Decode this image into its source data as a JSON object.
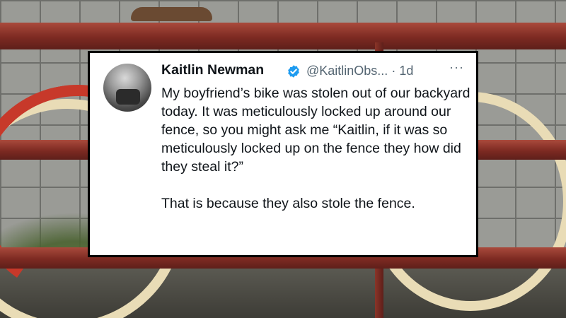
{
  "tweet": {
    "author_name": "Kaitlin Newman",
    "handle": "@KaitlinObs...",
    "separator": "·",
    "time": "1d",
    "more_label": "···",
    "paragraphs": [
      "My boyfriend’s bike was stolen out of our backyard today. It was meticulously locked up around our fence, so you might ask me “Kaitlin, if it was so meticulously locked up on the fence they how did they steal it?”",
      "That is because they also stole the fence."
    ]
  },
  "colors": {
    "verified": "#1d9bf0",
    "name_text": "#0f1419",
    "secondary_text": "#536471",
    "rail": "#8a3428"
  },
  "icons": {
    "verified": "verified-badge-icon",
    "more": "more-options-icon"
  }
}
